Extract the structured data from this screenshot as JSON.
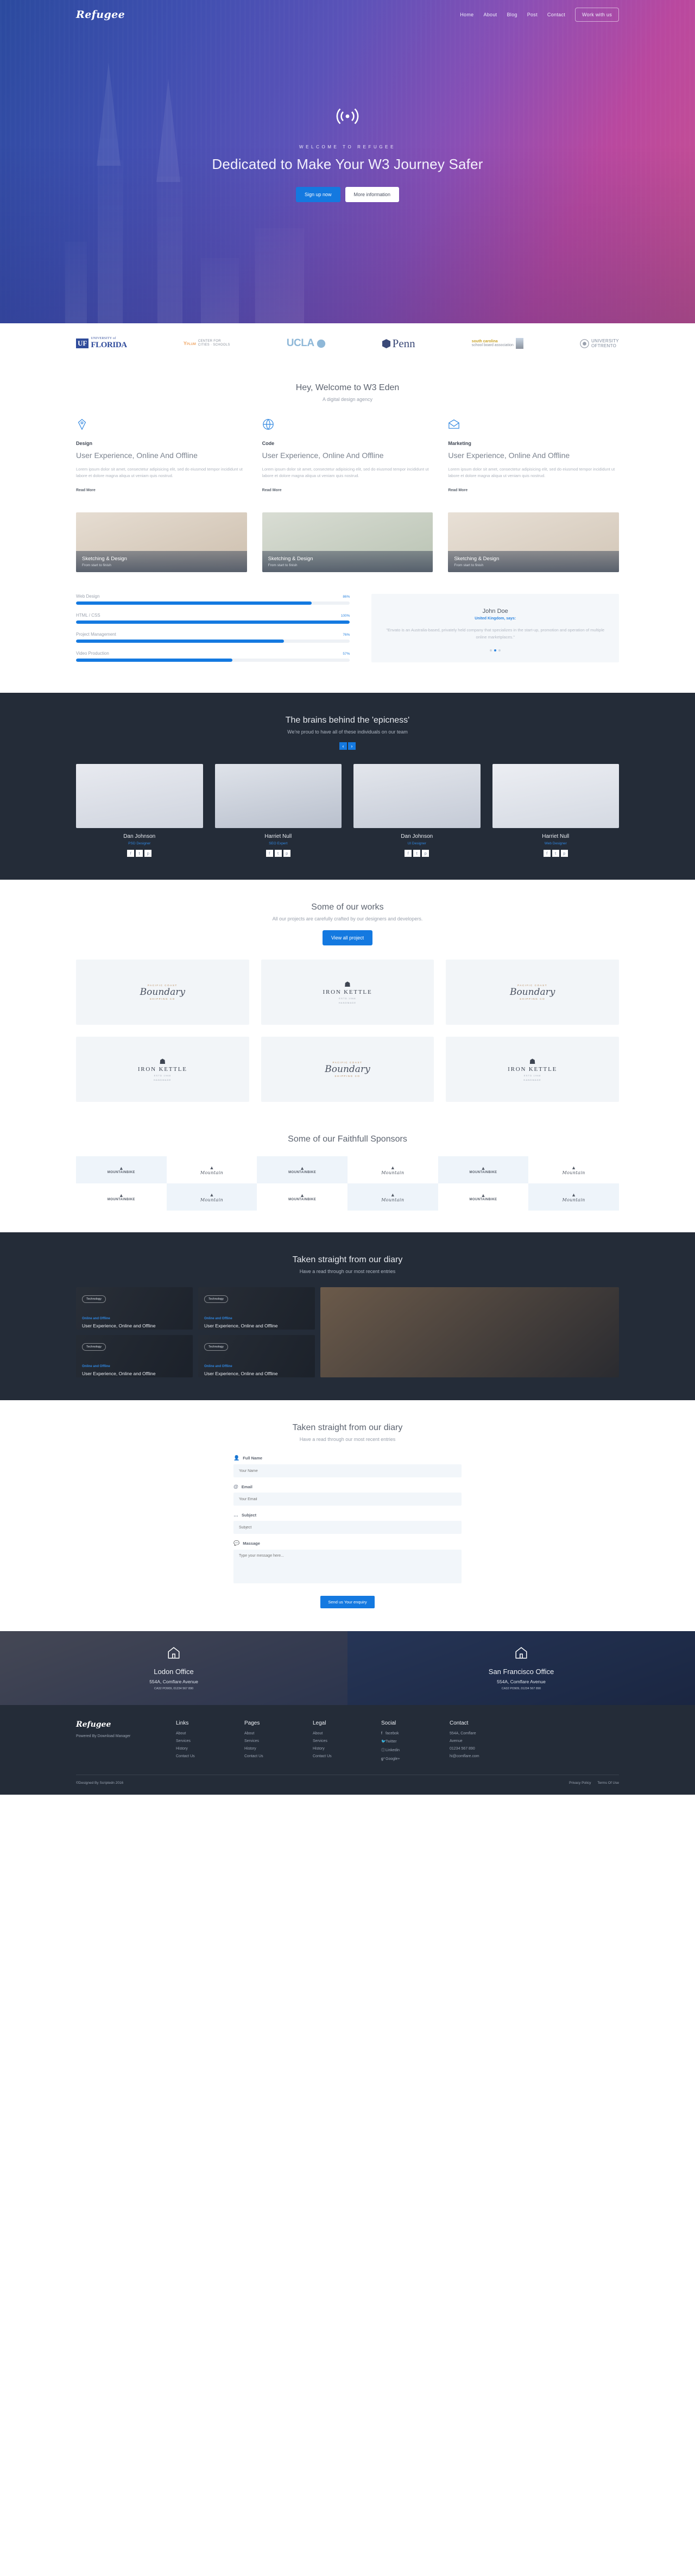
{
  "header": {
    "brand": "Refugee",
    "nav": [
      {
        "label": "Home",
        "cta": false
      },
      {
        "label": "About",
        "cta": false
      },
      {
        "label": "Blog",
        "cta": false
      },
      {
        "label": "Post",
        "cta": false
      },
      {
        "label": "Contact",
        "cta": false
      },
      {
        "label": "Work with us",
        "cta": true
      }
    ]
  },
  "hero": {
    "icon": "radar-signal-icon",
    "eyebrow": "WELCOME TO REFUGEE",
    "title": "Dedicated to Make Your W3 Journey Safer",
    "primary_button": "Sign up now",
    "secondary_button": "More information"
  },
  "partners": [
    {
      "name": "University of Florida",
      "type": "uf"
    },
    {
      "name": "PLUM Center for Cities + Schools",
      "type": "plum"
    },
    {
      "name": "UCLA",
      "type": "ucla"
    },
    {
      "name": "Penn",
      "type": "penn"
    },
    {
      "name": "South Carolina School Boards Association",
      "type": "sc"
    },
    {
      "name": "University of Trento",
      "type": "trento"
    }
  ],
  "intro": {
    "title": "Hey, Welcome to W3 Eden",
    "subtitle": "A digital design agency"
  },
  "services": [
    {
      "icon": "pen-tool-icon",
      "kicker": "Design",
      "title": "User Experience, Online And Offline",
      "body": "Lorem ipsum dolor sit amet, consectetur adipisicing elit, sed do eiusmod tempor incididunt ut labore et dolore magna aliqua ut veniam quis nostrud.",
      "link": "Read More"
    },
    {
      "icon": "globe-icon",
      "kicker": "Code",
      "title": "User Experience, Online And Offline",
      "body": "Lorem ipsum dolor sit amet, consectetur adipisicing elit, sed do eiusmod tempor incididunt ut labore et dolore magna aliqua ut veniam quis nostrud.",
      "link": "Read More"
    },
    {
      "icon": "envelope-open-icon",
      "kicker": "Marketing",
      "title": "User Experience, Online And Offline",
      "body": "Lorem ipsum dolor sit amet, consectetur adipisicing elit, sed do eiusmod tempor incididunt ut labore et dolore magna aliqua ut veniam quis nostrud.",
      "link": "Read More"
    }
  ],
  "feature_cards": [
    {
      "title": "Sketching & Design",
      "subtitle": "From start to finish"
    },
    {
      "title": "Sketching & Design",
      "subtitle": "From start to finish"
    },
    {
      "title": "Sketching & Design",
      "subtitle": "From start to finish"
    }
  ],
  "skills": [
    {
      "label": "Web Design",
      "percent": "86%",
      "value": 86
    },
    {
      "label": "HTML / CSS",
      "percent": "100%",
      "value": 100
    },
    {
      "label": "Project Management",
      "percent": "76%",
      "value": 76
    },
    {
      "label": "Video Production",
      "percent": "57%",
      "value": 57
    }
  ],
  "testimonial": {
    "name": "John Doe",
    "location": "United Kingdom, says:",
    "quote": "\"Envato is an Australia-based, privately held company that specializes in the start-up, promotion and operation of multiple online marketplaces.\"",
    "dots": 3,
    "active_dot": 2
  },
  "team_section": {
    "title": "The brains behind the 'epicness'",
    "subtitle": "We're proud to have all of these individuals on our team",
    "prev": "‹",
    "next": "›",
    "members": [
      {
        "name": "Dan Johnson",
        "role": "PSD Designer",
        "socials": [
          "f",
          "t",
          "p"
        ]
      },
      {
        "name": "Harriet Null",
        "role": "SEO Expert",
        "socials": [
          "f",
          "t",
          "p"
        ]
      },
      {
        "name": "Dan Johnson",
        "role": "UI Designer",
        "socials": [
          "f",
          "t",
          "p"
        ]
      },
      {
        "name": "Harriet Null",
        "role": "Web Designer",
        "socials": [
          "f",
          "t",
          "p"
        ]
      }
    ]
  },
  "works_section": {
    "title": "Some of our works",
    "subtitle": "All our projects are carefully crafted by our designers and developers.",
    "button": "View all project",
    "items": [
      {
        "style": "boundary",
        "arc_top": "PACIFIC COAST",
        "script": "Boundary",
        "arc_bottom": "SHIPPING CO"
      },
      {
        "style": "kettle",
        "name": "IRON KETTLE",
        "sub": "ESTD    1968",
        "tiny": "HANDMADE"
      },
      {
        "style": "boundary",
        "arc_top": "PACIFIC COAST",
        "script": "Boundary",
        "arc_bottom": "SHIPPING CO"
      },
      {
        "style": "kettle",
        "name": "IRON KETTLE",
        "sub": "ESTD    1968",
        "tiny": "HANDMADE"
      },
      {
        "style": "boundary",
        "arc_top": "PACIFIC COAST",
        "script": "Boundary",
        "arc_bottom": "SHIPPING CO"
      },
      {
        "style": "kettle",
        "name": "IRON KETTLE",
        "sub": "ESTD    1968",
        "tiny": "HANDMADE"
      }
    ]
  },
  "sponsors_section": {
    "title": "Some of our Faithfull Sponsors",
    "items": [
      {
        "peak": "PREMIUM QUALITY",
        "name": "MOUNTAINBIKE",
        "script": false
      },
      {
        "peak": "WINTER SPORTS",
        "name": "Mountain",
        "script": true
      },
      {
        "peak": "PREMIUM QUALITY",
        "name": "MOUNTAINBIKE",
        "script": false
      },
      {
        "peak": "WINTER SPORTS",
        "name": "Mountain",
        "script": true
      },
      {
        "peak": "PREMIUM QUALITY",
        "name": "MOUNTAINBIKE",
        "script": false
      },
      {
        "peak": "WINTER SPORTS",
        "name": "Mountain",
        "script": true
      },
      {
        "peak": "PREMIUM QUALITY",
        "name": "MOUNTAINBIKE",
        "script": false
      },
      {
        "peak": "WINTER SPORTS",
        "name": "Mountain",
        "script": true
      },
      {
        "peak": "PREMIUM QUALITY",
        "name": "MOUNTAINBIKE",
        "script": false
      },
      {
        "peak": "WINTER SPORTS",
        "name": "Mountain",
        "script": true
      },
      {
        "peak": "PREMIUM QUALITY",
        "name": "MOUNTAINBIKE",
        "script": false
      },
      {
        "peak": "WINTER SPORTS",
        "name": "Mountain",
        "script": true
      }
    ]
  },
  "diary_section": {
    "title": "Taken straight from our diary",
    "subtitle": "Have a read through our most recent entries",
    "posts": [
      {
        "tag": "Technology",
        "kicker": "Online and Offline",
        "title": "User Experience, Online and Offline"
      },
      {
        "tag": "Technology",
        "kicker": "Online and Offline",
        "title": "User Experience, Online and Offline"
      },
      {
        "tag": "Technology",
        "kicker": "Online and Offline",
        "title": "User Experience, Online and Offline"
      },
      {
        "tag": "Technology",
        "kicker": "Online and Offline",
        "title": "User Experience, Online and Offline"
      }
    ]
  },
  "contact_section": {
    "title": "Taken straight from our diary",
    "subtitle": "Have a read through our most recent entries",
    "fields": [
      {
        "icon": "user-icon",
        "label": "Full Name",
        "placeholder": "Your Name",
        "type": "text"
      },
      {
        "icon": "at-icon",
        "label": "Email",
        "placeholder": "Your Email",
        "type": "text"
      },
      {
        "icon": "dots-icon",
        "label": "Subject",
        "placeholder": "Subject",
        "type": "text"
      },
      {
        "icon": "comment-icon",
        "label": "Massage",
        "placeholder": "Type your message here...",
        "type": "textarea"
      }
    ],
    "submit": "Send us Your enquiry"
  },
  "offices": [
    {
      "icon": "home-icon",
      "name": "Lodon Office",
      "address": "554A, Comflare Avenue",
      "phone": "CA32 PO909, 01234 567 890"
    },
    {
      "icon": "home-icon",
      "name": "San Francisco Office",
      "address": "554A, Comflare Avenue",
      "phone": "CA32 PO909, 01234 567 890"
    }
  ],
  "footer": {
    "brand": "Refugee",
    "tagline": "Powered By Download Manager",
    "columns": [
      {
        "title": "Links",
        "items": [
          {
            "label": "About"
          },
          {
            "label": "Services"
          },
          {
            "label": "History"
          },
          {
            "label": "Contact Us"
          }
        ]
      },
      {
        "title": "Pages",
        "items": [
          {
            "label": "About"
          },
          {
            "label": "Services"
          },
          {
            "label": "History"
          },
          {
            "label": "Contact Us"
          }
        ]
      },
      {
        "title": "Legal",
        "items": [
          {
            "label": "About"
          },
          {
            "label": "Services"
          },
          {
            "label": "History"
          },
          {
            "label": "Contact Us"
          }
        ]
      },
      {
        "title": "Social",
        "items": [
          {
            "label": "facebok",
            "icon": "f"
          },
          {
            "label": "Twitter",
            "icon": "🐦"
          },
          {
            "label": "Linkedin",
            "icon": "ⓘ"
          },
          {
            "label": "Google+",
            "icon": "g⁺"
          }
        ]
      },
      {
        "title": "Contact",
        "items": [
          {
            "label": "554A, Comflare"
          },
          {
            "label": "Avenue"
          },
          {
            "label": "01234 567 890"
          },
          {
            "label": "hi@comflare.com"
          }
        ]
      }
    ],
    "copyright": "©Designed By Scriptedn 2016",
    "legal_links": [
      {
        "label": "Privacy Policy"
      },
      {
        "label": "Terms Of Use"
      }
    ]
  },
  "colors": {
    "accent": "#1479e0",
    "dark": "#242c38",
    "muted": "#9aa1ad",
    "panel": "#f2f6fa"
  }
}
